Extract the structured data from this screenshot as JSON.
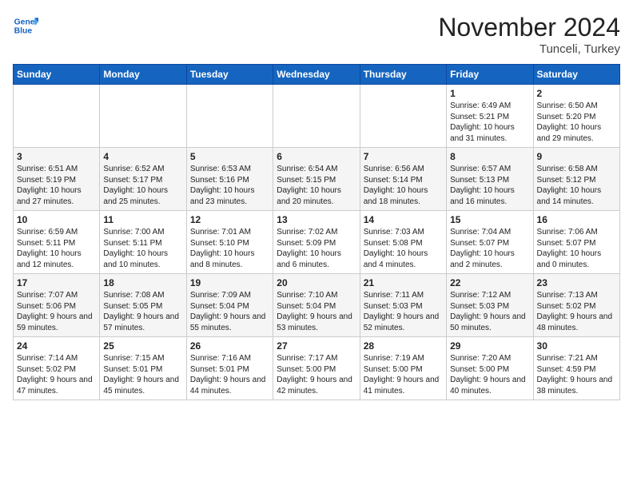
{
  "header": {
    "logo_line1": "General",
    "logo_line2": "Blue",
    "month_year": "November 2024",
    "location": "Tunceli, Turkey"
  },
  "weekdays": [
    "Sunday",
    "Monday",
    "Tuesday",
    "Wednesday",
    "Thursday",
    "Friday",
    "Saturday"
  ],
  "weeks": [
    [
      {
        "day": "",
        "info": ""
      },
      {
        "day": "",
        "info": ""
      },
      {
        "day": "",
        "info": ""
      },
      {
        "day": "",
        "info": ""
      },
      {
        "day": "",
        "info": ""
      },
      {
        "day": "1",
        "info": "Sunrise: 6:49 AM\nSunset: 5:21 PM\nDaylight: 10 hours and 31 minutes."
      },
      {
        "day": "2",
        "info": "Sunrise: 6:50 AM\nSunset: 5:20 PM\nDaylight: 10 hours and 29 minutes."
      }
    ],
    [
      {
        "day": "3",
        "info": "Sunrise: 6:51 AM\nSunset: 5:19 PM\nDaylight: 10 hours and 27 minutes."
      },
      {
        "day": "4",
        "info": "Sunrise: 6:52 AM\nSunset: 5:17 PM\nDaylight: 10 hours and 25 minutes."
      },
      {
        "day": "5",
        "info": "Sunrise: 6:53 AM\nSunset: 5:16 PM\nDaylight: 10 hours and 23 minutes."
      },
      {
        "day": "6",
        "info": "Sunrise: 6:54 AM\nSunset: 5:15 PM\nDaylight: 10 hours and 20 minutes."
      },
      {
        "day": "7",
        "info": "Sunrise: 6:56 AM\nSunset: 5:14 PM\nDaylight: 10 hours and 18 minutes."
      },
      {
        "day": "8",
        "info": "Sunrise: 6:57 AM\nSunset: 5:13 PM\nDaylight: 10 hours and 16 minutes."
      },
      {
        "day": "9",
        "info": "Sunrise: 6:58 AM\nSunset: 5:12 PM\nDaylight: 10 hours and 14 minutes."
      }
    ],
    [
      {
        "day": "10",
        "info": "Sunrise: 6:59 AM\nSunset: 5:11 PM\nDaylight: 10 hours and 12 minutes."
      },
      {
        "day": "11",
        "info": "Sunrise: 7:00 AM\nSunset: 5:11 PM\nDaylight: 10 hours and 10 minutes."
      },
      {
        "day": "12",
        "info": "Sunrise: 7:01 AM\nSunset: 5:10 PM\nDaylight: 10 hours and 8 minutes."
      },
      {
        "day": "13",
        "info": "Sunrise: 7:02 AM\nSunset: 5:09 PM\nDaylight: 10 hours and 6 minutes."
      },
      {
        "day": "14",
        "info": "Sunrise: 7:03 AM\nSunset: 5:08 PM\nDaylight: 10 hours and 4 minutes."
      },
      {
        "day": "15",
        "info": "Sunrise: 7:04 AM\nSunset: 5:07 PM\nDaylight: 10 hours and 2 minutes."
      },
      {
        "day": "16",
        "info": "Sunrise: 7:06 AM\nSunset: 5:07 PM\nDaylight: 10 hours and 0 minutes."
      }
    ],
    [
      {
        "day": "17",
        "info": "Sunrise: 7:07 AM\nSunset: 5:06 PM\nDaylight: 9 hours and 59 minutes."
      },
      {
        "day": "18",
        "info": "Sunrise: 7:08 AM\nSunset: 5:05 PM\nDaylight: 9 hours and 57 minutes."
      },
      {
        "day": "19",
        "info": "Sunrise: 7:09 AM\nSunset: 5:04 PM\nDaylight: 9 hours and 55 minutes."
      },
      {
        "day": "20",
        "info": "Sunrise: 7:10 AM\nSunset: 5:04 PM\nDaylight: 9 hours and 53 minutes."
      },
      {
        "day": "21",
        "info": "Sunrise: 7:11 AM\nSunset: 5:03 PM\nDaylight: 9 hours and 52 minutes."
      },
      {
        "day": "22",
        "info": "Sunrise: 7:12 AM\nSunset: 5:03 PM\nDaylight: 9 hours and 50 minutes."
      },
      {
        "day": "23",
        "info": "Sunrise: 7:13 AM\nSunset: 5:02 PM\nDaylight: 9 hours and 48 minutes."
      }
    ],
    [
      {
        "day": "24",
        "info": "Sunrise: 7:14 AM\nSunset: 5:02 PM\nDaylight: 9 hours and 47 minutes."
      },
      {
        "day": "25",
        "info": "Sunrise: 7:15 AM\nSunset: 5:01 PM\nDaylight: 9 hours and 45 minutes."
      },
      {
        "day": "26",
        "info": "Sunrise: 7:16 AM\nSunset: 5:01 PM\nDaylight: 9 hours and 44 minutes."
      },
      {
        "day": "27",
        "info": "Sunrise: 7:17 AM\nSunset: 5:00 PM\nDaylight: 9 hours and 42 minutes."
      },
      {
        "day": "28",
        "info": "Sunrise: 7:19 AM\nSunset: 5:00 PM\nDaylight: 9 hours and 41 minutes."
      },
      {
        "day": "29",
        "info": "Sunrise: 7:20 AM\nSunset: 5:00 PM\nDaylight: 9 hours and 40 minutes."
      },
      {
        "day": "30",
        "info": "Sunrise: 7:21 AM\nSunset: 4:59 PM\nDaylight: 9 hours and 38 minutes."
      }
    ]
  ]
}
